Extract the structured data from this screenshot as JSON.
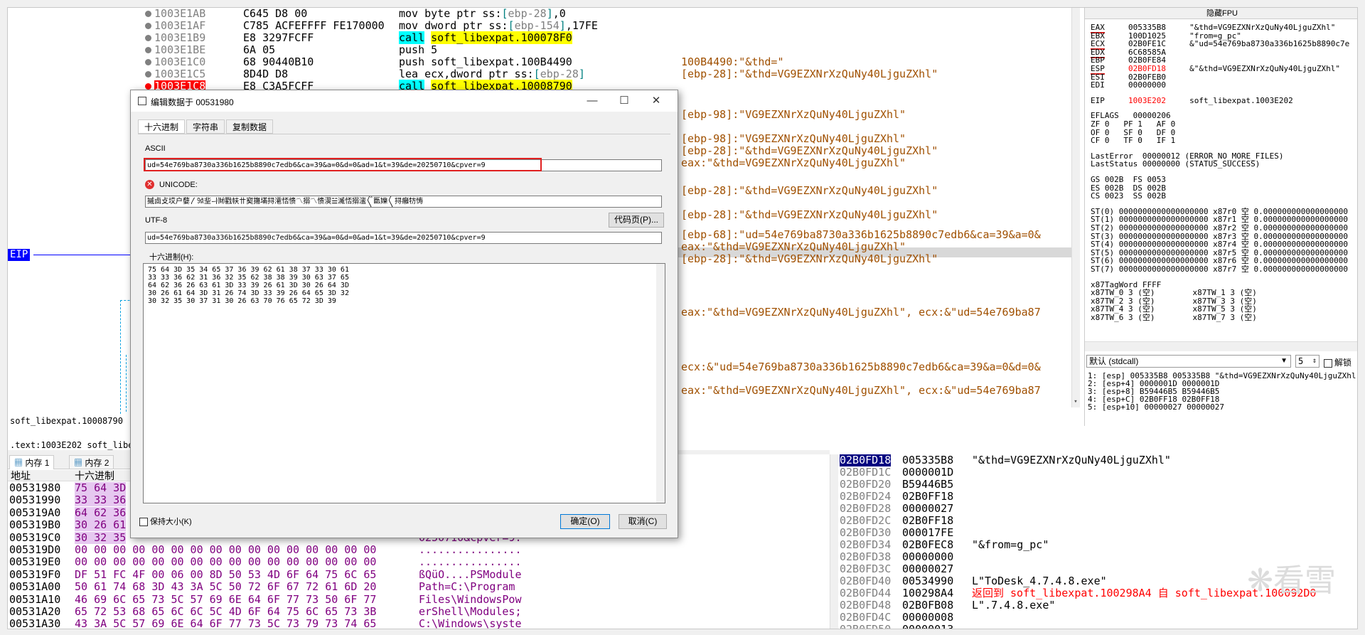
{
  "cpu": {
    "rows": [
      {
        "addr": "1003E1AB",
        "bytes": "C645 D8 00",
        "instr_parts": [
          {
            "t": "mov byte ptr ss:",
            "c": ""
          },
          {
            "t": "[",
            "c": "brk"
          },
          {
            "t": "ebp-28",
            "c": "gray"
          },
          {
            "t": "]",
            "c": "brk"
          },
          {
            "t": ",0",
            "c": ""
          }
        ],
        "comment": ""
      },
      {
        "addr": "1003E1AF",
        "bytes": "C785 ACFEFFFF FE170000",
        "instr_parts": [
          {
            "t": "mov dword ptr ss:",
            "c": ""
          },
          {
            "t": "[",
            "c": "brk"
          },
          {
            "t": "ebp-154",
            "c": "gray"
          },
          {
            "t": "]",
            "c": "brk"
          },
          {
            "t": ",17FE",
            "c": ""
          }
        ],
        "comment": ""
      },
      {
        "addr": "1003E1B9",
        "bytes": "E8 3297FCFF",
        "instr_parts": [
          {
            "t": "call",
            "c": "hl-call"
          },
          {
            "t": " ",
            "c": ""
          },
          {
            "t": "soft_libexpat.100078F0",
            "c": "hl-fn"
          }
        ],
        "comment": ""
      },
      {
        "addr": "1003E1BE",
        "bytes": "6A 05",
        "instr_parts": [
          {
            "t": "push 5",
            "c": ""
          }
        ],
        "comment": ""
      },
      {
        "addr": "1003E1C0",
        "bytes": "68 90440B10",
        "instr_parts": [
          {
            "t": "push soft_libexpat.100B4490",
            "c": ""
          }
        ],
        "comment": "100B4490:\"&thd=\""
      },
      {
        "addr": "1003E1C5",
        "bytes": "8D4D D8",
        "instr_parts": [
          {
            "t": "lea ecx,dword ptr ss:",
            "c": ""
          },
          {
            "t": "[",
            "c": "brk"
          },
          {
            "t": "ebp-28",
            "c": "gray"
          },
          {
            "t": "]",
            "c": "brk"
          }
        ],
        "comment": "[ebp-28]:\"&thd=VG9EZXNrXzQuNy40LjguZXhl\""
      },
      {
        "addr": "1003E1C8",
        "bytes": "E8 C3A5FCFF",
        "instr_parts": [
          {
            "t": "call",
            "c": "hl-call"
          },
          {
            "t": " ",
            "c": ""
          },
          {
            "t": "soft_libexpat.10008790",
            "c": "hl-fn"
          }
        ],
        "comment": "",
        "bp": true
      }
    ],
    "comments": [
      "[ebp-98]:\"VG9EZXNrXzQuNy40LjguZXhl\"",
      "[ebp-98]:\"VG9EZXNrXzQuNy40LjguZXhl\"",
      "[ebp-28]:\"&thd=VG9EZXNrXzQuNy40LjguZXhl\"",
      "eax:\"&thd=VG9EZXNrXzQuNy40LjguZXhl\"",
      "[ebp-28]:\"&thd=VG9EZXNrXzQuNy40LjguZXhl\"",
      "[ebp-28]:\"&thd=VG9EZXNrXzQuNy40LjguZXhl\"",
      "[ebp-68]:\"ud=54e769ba8730a336b1625b8890c7edb6&ca=39&a=0&",
      "eax:\"&thd=VG9EZXNrXzQuNy40LjguZXhl\"",
      "[ebp-28]:\"&thd=VG9EZXNrXzQuNy40LjguZXhl\"",
      "eax:\"&thd=VG9EZXNrXzQuNy40LjguZXhl\", ecx:&\"ud=54e769ba87",
      "ecx:&\"ud=54e769ba8730a336b1625b8890c7edb6&ca=39&a=0&d=0&",
      "eax:\"&thd=VG9EZXNrXzQuNy40LjguZXhl\", ecx:&\"ud=54e769ba87"
    ],
    "eip_label": "EIP",
    "status1": "soft_libexpat.10008790",
    "status2": ".text:1003E202 soft_libe"
  },
  "registers": {
    "title": "隐藏FPU",
    "lines": [
      {
        "t": "EAX     005335B8     \"&thd=VG9EZXNrXzQuNy40LjguZXhl\"",
        "ul": "EAX"
      },
      {
        "t": "EBX     100D1025     \"from=g_pc\""
      },
      {
        "t": "ECX     02B0FE1C     &\"ud=54e769ba8730a336b1625b8890c7e",
        "ul": "ECX"
      },
      {
        "t": "EDX     6C68585A",
        "ul": "EDX"
      },
      {
        "t": "EBP     02B0FE84"
      },
      {
        "t": "ESP     02B0FD18     &\"&thd=VG9EZXNrXzQuNy40LjguZXhl\"",
        "ul": "ESP",
        "red": "02B0FD18"
      },
      {
        "t": "ESI     02B0FEB0"
      },
      {
        "t": "EDI     00000000"
      },
      {
        "t": ""
      },
      {
        "t": "EIP     1003E202     soft_libexpat.1003E202",
        "red": "1003E202"
      },
      {
        "t": ""
      },
      {
        "t": "EFLAGS   00000206"
      },
      {
        "t": "ZF 0   PF 1   AF 0"
      },
      {
        "t": "OF 0   SF 0   DF 0"
      },
      {
        "t": "CF 0   TF 0   IF 1"
      },
      {
        "t": ""
      },
      {
        "t": "LastError  00000012 (ERROR_NO_MORE_FILES)"
      },
      {
        "t": "LastStatus 00000000 (STATUS_SUCCESS)"
      },
      {
        "t": ""
      },
      {
        "t": "GS 002B  FS 0053"
      },
      {
        "t": "ES 002B  DS 002B"
      },
      {
        "t": "CS 0023  SS 002B"
      },
      {
        "t": ""
      },
      {
        "t": "ST(0) 0000000000000000000 x87r0 空 0.000000000000000000"
      },
      {
        "t": "ST(1) 0000000000000000000 x87r1 空 0.000000000000000000"
      },
      {
        "t": "ST(2) 0000000000000000000 x87r2 空 0.000000000000000000"
      },
      {
        "t": "ST(3) 0000000000000000000 x87r3 空 0.000000000000000000"
      },
      {
        "t": "ST(4) 0000000000000000000 x87r4 空 0.000000000000000000"
      },
      {
        "t": "ST(5) 0000000000000000000 x87r5 空 0.000000000000000000"
      },
      {
        "t": "ST(6) 0000000000000000000 x87r6 空 0.000000000000000000"
      },
      {
        "t": "ST(7) 0000000000000000000 x87r7 空 0.000000000000000000"
      },
      {
        "t": ""
      },
      {
        "t": "x87TagWord FFFF"
      },
      {
        "t": "x87TW_0 3 (空)        x87TW_1 3 (空)"
      },
      {
        "t": "x87TW_2 3 (空)        x87TW_3 3 (空)"
      },
      {
        "t": "x87TW_4 3 (空)        x87TW_5 3 (空)"
      },
      {
        "t": "x87TW_6 3 (空)        x87TW_7 3 (空)"
      }
    ],
    "callconv": "默认 (stdcall)",
    "stack_count": "5",
    "unlock_label": "解锁",
    "stack_args": [
      "1: [esp] 005335B8 005335B8 \"&thd=VG9EZXNrXzQuNy40LjguZXhl\"",
      "2: [esp+4] 0000001D 0000001D",
      "3: [esp+8] B59446B5 B59446B5",
      "4: [esp+C] 02B0FF18 02B0FF18",
      "5: [esp+10] 00000027 00000027"
    ]
  },
  "dump": {
    "tabs": [
      "内存 1",
      "内存 2"
    ],
    "col_addr": "地址",
    "col_hex": "十六进制",
    "rows": [
      {
        "a": "00531980",
        "h": "75 64 3D",
        "c": ""
      },
      {
        "a": "00531990",
        "h": "33 33 36",
        "c": ""
      },
      {
        "a": "005319A0",
        "h": "64 62 36",
        "c": ""
      },
      {
        "a": "005319B0",
        "h": "30 26 61",
        "c": ""
      },
      {
        "a": "005319C0",
        "h": "30 32 35",
        "c": "0250710&cpver=9."
      },
      {
        "a": "005319D0",
        "h": "00 00 00 00 00 00 00 00 00 00 00 00 00 00 00 00",
        "c": "................"
      },
      {
        "a": "005319E0",
        "h": "00 00 00 00 00 00 00 00 00 00 00 00 00 00 00 00",
        "c": "................"
      },
      {
        "a": "005319F0",
        "h": "DF 51 FC 4F 00 06 00 8D 50 53 4D 6F 64 75 6C 65",
        "c": "ßQüO....PSModule"
      },
      {
        "a": "00531A00",
        "h": "50 61 74 68 3D 43 3A 5C 50 72 6F 67 72 61 6D 20",
        "c": "Path=C:\\Program "
      },
      {
        "a": "00531A10",
        "h": "46 69 6C 65 73 5C 57 69 6E 64 6F 77 73 50 6F 77",
        "c": "Files\\WindowsPow"
      },
      {
        "a": "00531A20",
        "h": "65 72 53 68 65 6C 6C 5C 4D 6F 64 75 6C 65 73 3B",
        "c": "erShell\\Modules;"
      },
      {
        "a": "00531A30",
        "h": "43 3A 5C 57 69 6E 64 6F 77 73 5C 73 79 73 74 65",
        "c": "C:\\Windows\\syste"
      }
    ]
  },
  "stack": {
    "rows": [
      {
        "a": "02B0FD18",
        "v": "005335B8",
        "c": "\"&thd=VG9EZXNrXzQuNy40LjguZXhl\"",
        "sel": true
      },
      {
        "a": "02B0FD1C",
        "v": "0000001D",
        "c": ""
      },
      {
        "a": "02B0FD20",
        "v": "B59446B5",
        "c": ""
      },
      {
        "a": "02B0FD24",
        "v": "02B0FF18",
        "c": ""
      },
      {
        "a": "02B0FD28",
        "v": "00000027",
        "c": ""
      },
      {
        "a": "02B0FD2C",
        "v": "02B0FF18",
        "c": ""
      },
      {
        "a": "02B0FD30",
        "v": "000017FE",
        "c": ""
      },
      {
        "a": "02B0FD34",
        "v": "02B0FEC8",
        "c": "\"&from=g_pc\""
      },
      {
        "a": "02B0FD38",
        "v": "00000000",
        "c": ""
      },
      {
        "a": "02B0FD3C",
        "v": "00000027",
        "c": ""
      },
      {
        "a": "02B0FD40",
        "v": "00534990",
        "c": "L\"ToDesk_4.7.4.8.exe\""
      },
      {
        "a": "02B0FD44",
        "v": "100298A4",
        "c": "返回到 soft_libexpat.100298A4 自 soft_libexpat.100092D0",
        "red": true
      },
      {
        "a": "02B0FD48",
        "v": "02B0FB08",
        "c": "L\".7.4.8.exe\""
      },
      {
        "a": "02B0FD4C",
        "v": "00000008",
        "c": ""
      },
      {
        "a": "02B0FD50",
        "v": "00000013",
        "c": ""
      }
    ]
  },
  "dialog": {
    "title": "编辑数据于 00531980",
    "tabs": [
      "十六进制",
      "字符串",
      "复制数据"
    ],
    "ascii_label": "ASCII",
    "ascii_value": "ud=54e769ba8730a336b1625b8890c7edb6&ca=39&a=0&d=0&ad=1&t=39&de=20250710&cpver=9",
    "unicode_label": "UNICODE:",
    "unicode_value": "摵㔽攴㘷户㜸〳㍡㘳ㅢ㈶戵㠸〹㝣摥㙢挦㵡㤳愦〽搦〽愦㵤☱㵴㤳搦㵥〲㔲㜰〱挦癰牥㤽",
    "utf8_label": "UTF-8",
    "codepage_button": "代码页(P)...",
    "utf8_value": "ud=54e769ba8730a336b1625b8890c7edb6&ca=39&a=0&d=0&ad=1&t=39&de=20250710&cpver=9",
    "hex_label": "十六进制(H):",
    "hex_lines": [
      "75 64 3D 35 34 65 37 36 39 62 61 38 37 33 30 61",
      "33 33 36 62 31 36 32 35 62 38 38 39 30 63 37 65",
      "64 62 36 26 63 61 3D 33 39 26 61 3D 30 26 64 3D",
      "30 26 61 64 3D 31 26 74 3D 33 39 26 64 65 3D 32",
      "30 32 35 30 37 31 30 26 63 70 76 65 72 3D 39"
    ],
    "keep_size_label": "保持大小(K)",
    "ok_button": "确定(O)",
    "cancel_button": "取消(C)"
  },
  "watermark": "看雪"
}
